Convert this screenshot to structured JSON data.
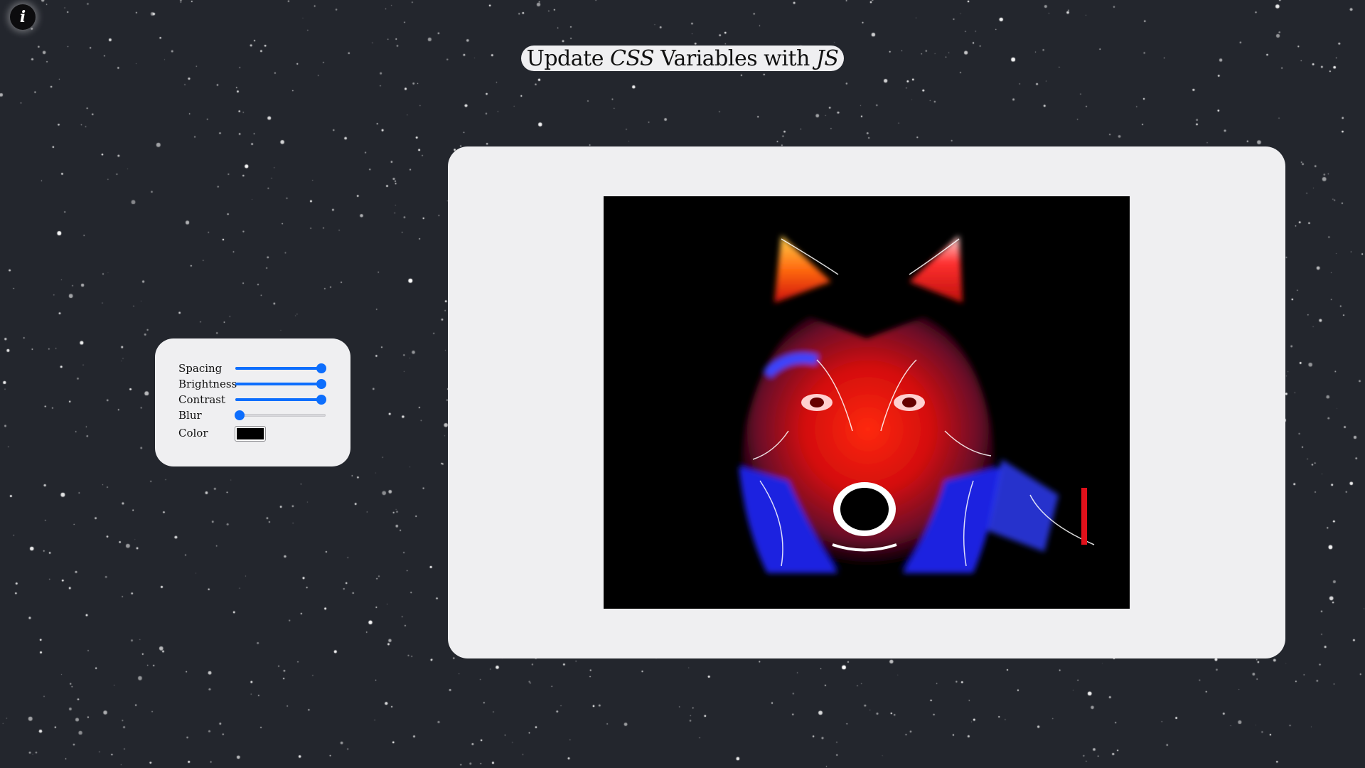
{
  "page": {
    "background_color": "#23262d",
    "accent_color": "#0d6efd",
    "panel_color": "#efeff1"
  },
  "header": {
    "title_parts": [
      "Update ",
      "CSS",
      " Variables with ",
      "JS"
    ]
  },
  "info_button": {
    "glyph": "i",
    "icon": "info-icon"
  },
  "controls": {
    "spacing": {
      "label": "Spacing",
      "value_fraction": 0.95
    },
    "brightness": {
      "label": "Brightness",
      "value_fraction": 0.95
    },
    "contrast": {
      "label": "Contrast",
      "value_fraction": 0.95
    },
    "blur": {
      "label": "Blur",
      "value_fraction": 0.05
    },
    "color": {
      "label": "Color",
      "value": "#000000"
    }
  },
  "image": {
    "subject": "wolf-artwork",
    "frame_color": "#000000"
  }
}
